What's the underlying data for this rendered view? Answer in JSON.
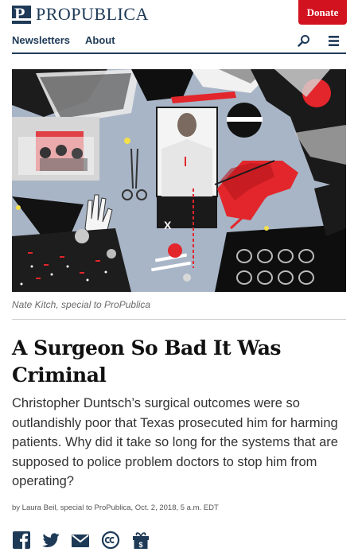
{
  "header": {
    "logo_text": "PROPUBLICA",
    "logo_mark": "P",
    "donate_label": "Donate"
  },
  "nav": {
    "items": [
      {
        "label": "Newsletters"
      },
      {
        "label": "About"
      }
    ],
    "search_icon": "search-icon",
    "menu_icon": "hamburger-menu-icon"
  },
  "hero": {
    "caption": "Nate Kitch, special to ProPublica",
    "overlay_mark": "X"
  },
  "article": {
    "headline": "A Surgeon So Bad It Was Criminal",
    "deck": "Christopher Duntsch’s surgical outcomes were so outlandishly poor that Texas prosecuted him for harming patients. Why did it take so long for the systems that are supposed to police problem doctors to stop him from operating?",
    "byline": "by Laura Beil, special to ProPublica, Oct. 2, 2018, 5 a.m. EDT"
  },
  "share": [
    {
      "icon": "facebook-icon"
    },
    {
      "icon": "twitter-icon"
    },
    {
      "icon": "email-icon"
    },
    {
      "icon": "creative-commons-icon"
    },
    {
      "icon": "gift-donate-icon"
    }
  ],
  "colors": {
    "brand_navy": "#1e3a57",
    "donate_red": "#d2121f",
    "accent_red": "#e2262b"
  }
}
